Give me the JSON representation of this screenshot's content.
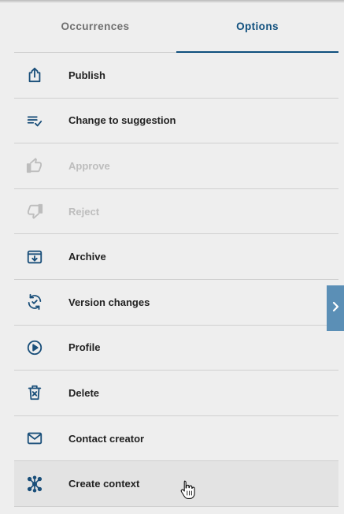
{
  "tabs": [
    {
      "label": "Occurrences",
      "active": false
    },
    {
      "label": "Options",
      "active": true
    }
  ],
  "menu": {
    "items": [
      {
        "label": "Publish",
        "icon": "publish-icon",
        "enabled": true
      },
      {
        "label": "Change to suggestion",
        "icon": "checklist-icon",
        "enabled": true
      },
      {
        "label": "Approve",
        "icon": "thumbs-up-icon",
        "enabled": false
      },
      {
        "label": "Reject",
        "icon": "thumbs-down-icon",
        "enabled": false
      },
      {
        "label": "Archive",
        "icon": "archive-icon",
        "enabled": true
      },
      {
        "label": "Version changes",
        "icon": "version-sync-icon",
        "enabled": true
      },
      {
        "label": "Profile",
        "icon": "play-circle-icon",
        "enabled": true
      },
      {
        "label": "Delete",
        "icon": "delete-icon",
        "enabled": true
      },
      {
        "label": "Contact creator",
        "icon": "mail-icon",
        "enabled": true
      },
      {
        "label": "Create context",
        "icon": "network-icon",
        "enabled": true,
        "hovered": true
      }
    ]
  },
  "side_toggle": {
    "icon": "chevron-right-icon"
  },
  "colors": {
    "accent": "#0f4f7d",
    "icon": "#1a4f7a",
    "disabled": "#bdbdbd",
    "toggle": "#5b8fb6",
    "background": "#eeeeee"
  }
}
